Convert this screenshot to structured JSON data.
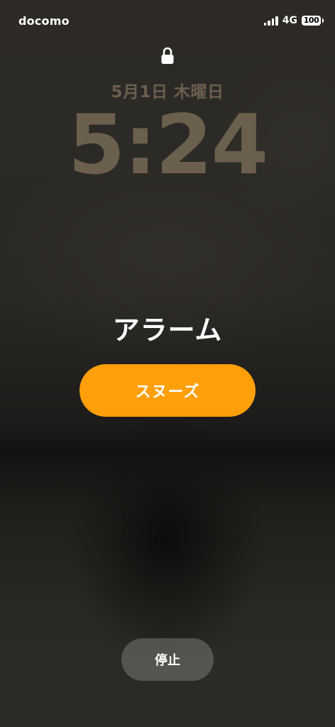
{
  "status_bar": {
    "carrier": "docomo",
    "network": "4G",
    "battery": "100",
    "signal_icon": "cellular-signal-icon",
    "battery_icon": "battery-icon"
  },
  "lock_screen": {
    "lock_icon": "lock-icon",
    "date": "5月1日 木曜日",
    "time": "5:24",
    "clock_color": "#6b5f4d"
  },
  "alarm": {
    "title": "アラーム",
    "snooze_label": "スヌーズ",
    "snooze_color": "#ff9f0a",
    "stop_label": "停止"
  }
}
